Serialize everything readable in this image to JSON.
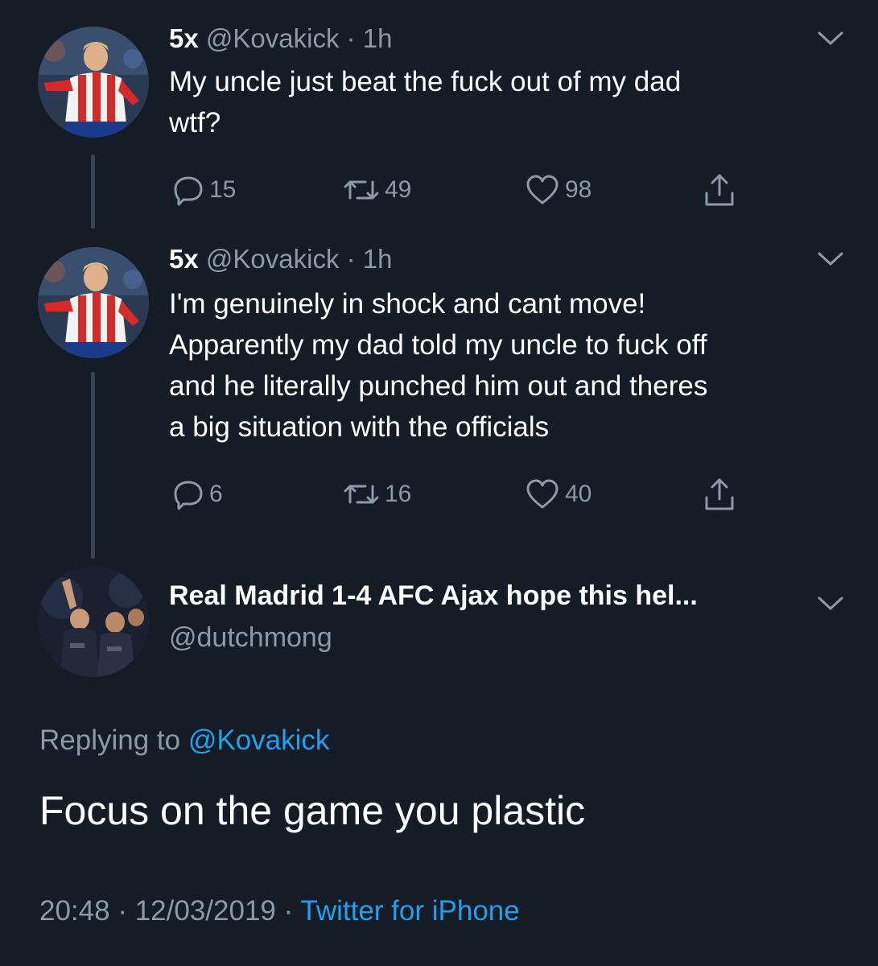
{
  "tweets": [
    {
      "display_name": "5x",
      "handle": "@Kovakick",
      "separator": "·",
      "time": "1h",
      "text_lines": [
        "My uncle just beat the fuck out of my dad",
        "wtf?"
      ],
      "replies": "15",
      "retweets": "49",
      "likes": "98"
    },
    {
      "display_name": "5x",
      "handle": "@Kovakick",
      "separator": "·",
      "time": "1h",
      "text_lines": [
        "I'm genuinely in shock and cant move!",
        "Apparently my dad told my uncle to fuck off",
        "and he literally punched him out and theres",
        "a big situation with the officials"
      ],
      "replies": "6",
      "retweets": "16",
      "likes": "40"
    }
  ],
  "reply": {
    "display_name": "Real Madrid 1-4 AFC Ajax hope this hel...",
    "handle": "@dutchmong",
    "replying_prefix": "Replying to",
    "replying_handle": "@Kovakick",
    "text": "Focus on the game you plastic",
    "time": "20:48",
    "date": "12/03/2019",
    "separator": "·",
    "source": "Twitter for iPhone"
  },
  "icons": {
    "reply": "reply-icon",
    "retweet": "retweet-icon",
    "like": "heart-icon",
    "share": "share-icon",
    "more": "chevron-down-icon"
  },
  "colors": {
    "background": "#151c26",
    "secondary_text": "#8d99a6",
    "link": "#1da1f2",
    "thread_line": "#3a4450"
  }
}
